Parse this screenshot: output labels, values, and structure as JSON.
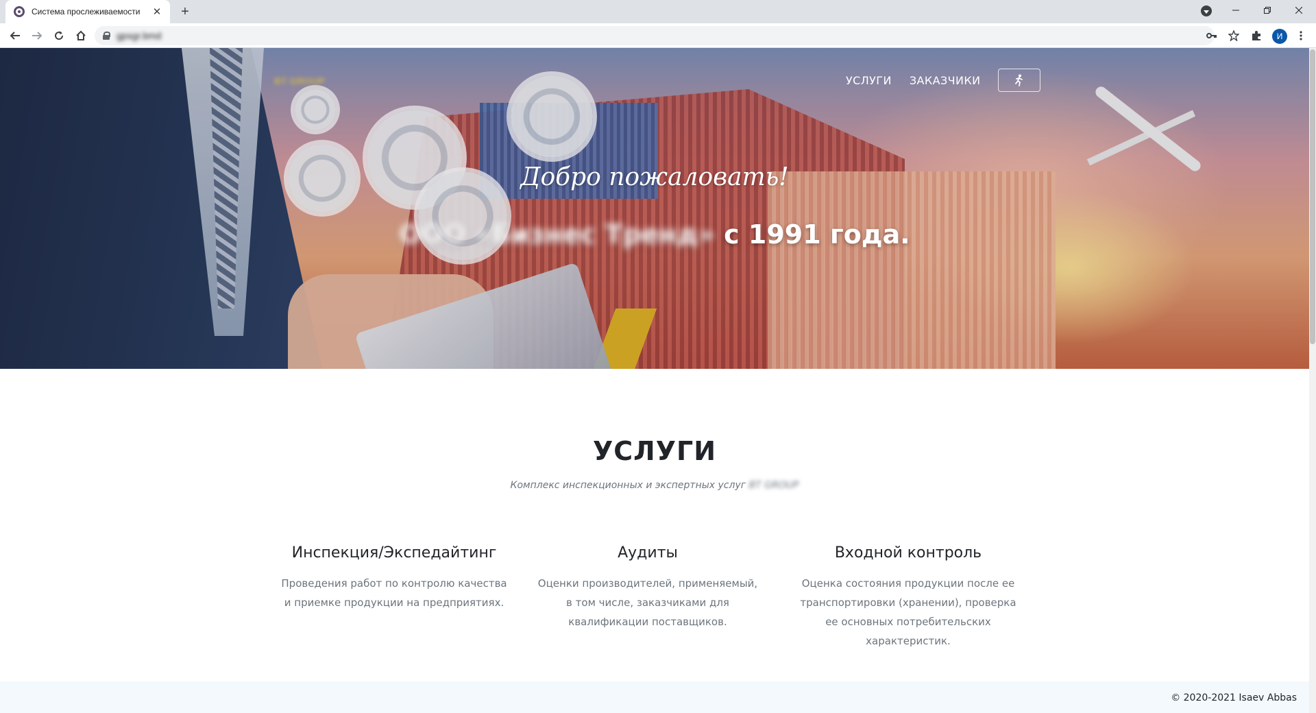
{
  "browser": {
    "tab_title": "Система прослеживаемости",
    "new_tab_symbol": "+",
    "close_symbol": "✕",
    "url": "gpsgr.bmd",
    "avatar_letter": "И"
  },
  "nav": {
    "services": "УСЛУГИ",
    "customers": "ЗАКАЗЧИКИ"
  },
  "hero": {
    "welcome": "Добро пожаловать!",
    "company_blurred": "ООО «Бизнес Тренд»",
    "since": "с 1991 года.",
    "logo_blurred": "BT GROUP"
  },
  "services": {
    "title": "УСЛУГИ",
    "subtitle": "Комплекс инспекционных и экспертных услуг",
    "subtitle_blurred": "BT GROUP",
    "items": [
      {
        "title": "Инспекция/Экспедайтинг",
        "text": "Проведения работ по контролю качества и приемке продукции на предприятиях."
      },
      {
        "title": "Аудиты",
        "text": "Оценки производителей, применяемый, в том числе, заказчиками для квалификации поставщиков."
      },
      {
        "title": "Входной контроль",
        "text": "Оценка состояния продукции после ее транспортировки (хранении), проверка ее основных потребительских характеристик."
      }
    ]
  },
  "footer": {
    "copyright": "© 2020-2021 Isaev Abbas"
  }
}
